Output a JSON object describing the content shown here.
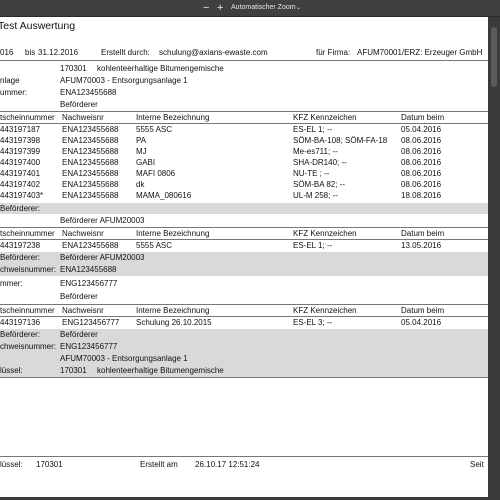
{
  "toolbar": {
    "zoom_out": "−",
    "zoom_in": "+",
    "zoom_level": "Automatischer Zoom",
    "zoom_chevron": "⌄"
  },
  "report": {
    "title": "Test Auswertung",
    "from": "016",
    "to_label": "bis",
    "to": "31.12.2016",
    "created_by_label": "Erstellt durch:",
    "created_by": "schulung@axians-ewaste.com",
    "company_label": "für Firma:",
    "company": "AFUM70001/ERZ: Erzeuger GmbH",
    "waste_code": "170301",
    "waste_desc": "kohlenteerhaltige Bitumengemische",
    "plant_label": "nlage",
    "plant": "AFUM70003 - Entsorgungsanlage 1",
    "number_label": "ummer:",
    "number": "ENA123455688",
    "befoerderer1": "Beförderer",
    "columns": [
      "tscheinnummer",
      "Nachweisnr",
      "Interne Bezeichnung",
      "KFZ Kennzeichen",
      "Datum beim"
    ],
    "group1_rows": [
      [
        "443197187",
        "ENA123455688",
        "5555 ASC",
        "ES-EL 1; --",
        "05.04.2016"
      ],
      [
        "443197398",
        "ENA123455688",
        "PA",
        "SÖM-BA-108; SÖM-FA-18",
        "08.06.2016"
      ],
      [
        "443197399",
        "ENA123455688",
        "MJ",
        "Me-es711; --",
        "08.06.2016"
      ],
      [
        "443197400",
        "ENA123455688",
        "GABI",
        "SHA-DR140; --",
        "08.06.2016"
      ],
      [
        "443197401",
        "ENA123455688",
        "MAFI 0806",
        "NU-TE ; --",
        "08.06.2016"
      ],
      [
        "443197402",
        "ENA123455688",
        "dk",
        "SÖM-BA 82; --",
        "08.06.2016"
      ],
      [
        "443197403*",
        "ENA123455688",
        "MAMA_080616",
        "UL-M 258; --",
        "18.08.2016"
      ]
    ],
    "band1_label": "Beförderer:",
    "befoerderer_afum": "Beförderer AFUM20003",
    "columns2": [
      "tscheinnummer",
      "Nachweisnr",
      "Interne Bezeichnung",
      "KFZ Kennzeichen",
      "Datum beim"
    ],
    "group2_rows": [
      [
        "443197238",
        "ENA123455688",
        "5555 ASC",
        "ES-EL 1; --",
        "13.05.2016"
      ]
    ],
    "band2_label": "Beförderer:",
    "band2_value": "Beförderer AFUM20003",
    "band3_label": "chweisnummer:",
    "band3_value": "ENA123455688",
    "number2_label": "mmer:",
    "number2": "ENG123456777",
    "befoerderer3": "Beförderer",
    "columns3": [
      "tscheinnummer",
      "Nachweisnr",
      "Interne Bezeichnung",
      "KFZ Kennzeichen",
      "Datum beim"
    ],
    "group3_rows": [
      [
        "443197136",
        "ENG123456777",
        "Schulung 26.10.2015",
        "ES-EL 3; --",
        "05.04.2016"
      ]
    ],
    "band4_label": "Beförderer:",
    "band4_value": "Beförderer",
    "band5_label": "chweisnummer:",
    "band5_value": "ENG123456777",
    "band6_value": "AFUM70003 - Entsorgungsanlage 1",
    "band7_label": "lüssel:",
    "band7_code": "170301",
    "band7_desc": "kohlenteerhaltige Bitumengemische",
    "footer": {
      "key_label": "lüssel:",
      "key": "170301",
      "created_label": "Erstellt am",
      "created": "26.10.17 12:51:24",
      "page_label": "Seit"
    }
  }
}
